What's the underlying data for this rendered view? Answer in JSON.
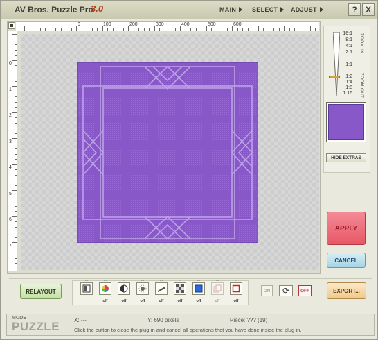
{
  "app": {
    "title": "AV Bros. Puzzle Pro",
    "version": "3.0"
  },
  "menu": [
    {
      "label": "MAIN"
    },
    {
      "label": "SELECT"
    },
    {
      "label": "ADJUST"
    }
  ],
  "window_buttons": {
    "help": "?",
    "close": "X"
  },
  "rulers": {
    "horizontal": [
      "0",
      "100",
      "200",
      "300",
      "400",
      "500",
      "600"
    ],
    "vertical": [
      "0",
      "1",
      "2",
      "3",
      "4",
      "5",
      "6",
      "7"
    ]
  },
  "zoom": {
    "levels_in": [
      "16:1",
      "8:1",
      "4:1",
      "2:1"
    ],
    "actual": "1:1",
    "levels_out": [
      "1:2",
      "1:4",
      "1:8",
      "1:16"
    ],
    "zoom_in_label": "ZOOM IN",
    "zoom_out_label": "ZOOM OUT"
  },
  "hide_extras_label": "HIDE EXTRAS",
  "apply_label": "APPLY",
  "cancel_label": "CANCEL",
  "relayout_label": "RELAYOUT",
  "toolbar": {
    "tools": [
      {
        "icon": "frame-icon",
        "off": ""
      },
      {
        "icon": "color-wheel-icon",
        "off": "off"
      },
      {
        "icon": "contrast-icon",
        "off": "off"
      },
      {
        "icon": "brightness-icon",
        "off": "off"
      },
      {
        "icon": "emboss-icon",
        "off": "off"
      },
      {
        "icon": "checker-icon",
        "off": "off"
      },
      {
        "icon": "blue-square-icon",
        "off": "off"
      },
      {
        "icon": "copy-icon",
        "off": "off"
      },
      {
        "icon": "red-square-icon",
        "off": "off"
      }
    ],
    "dots": "..."
  },
  "on_label": "ON",
  "off_label": "OFF",
  "export_label": "EXPORT...",
  "status": {
    "mode_label": "MODE",
    "mode_value": "PUZZLE",
    "x": "X: ---",
    "y": "Y: 690 pixels",
    "piece": "Piece: ??? (19)",
    "hint": "Click the button to close the plug-in and cancel all operations that you have done inside the plug-in."
  },
  "colors": {
    "puzzle_fill": "#8858c8",
    "apply": "#e85766",
    "cancel": "#a6d4e4",
    "relayout": "#c4e0a4",
    "export": "#f0c98a"
  }
}
